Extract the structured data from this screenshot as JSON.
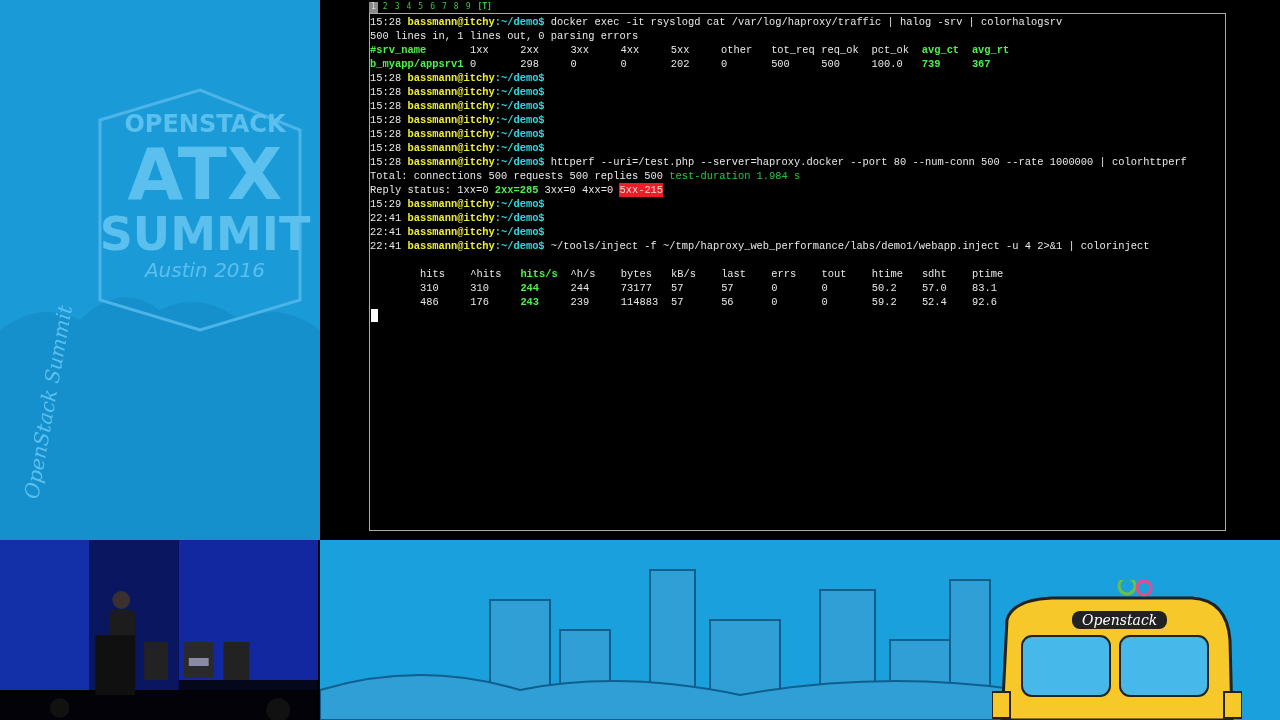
{
  "branding": {
    "logo_lines": [
      "OPENSTACK",
      "ATX",
      "SUMMIT",
      "Austin 2016"
    ],
    "vertical": "OpenStack Summit",
    "bus_label": "Openstack"
  },
  "tabs": [
    {
      "label": "1",
      "selected": true,
      "kind": "number"
    },
    {
      "label": "2",
      "selected": false,
      "kind": "number"
    },
    {
      "label": "3",
      "selected": false,
      "kind": "number"
    },
    {
      "label": "4",
      "selected": false,
      "kind": "number"
    },
    {
      "label": "5",
      "selected": false,
      "kind": "number"
    },
    {
      "label": "6",
      "selected": false,
      "kind": "number"
    },
    {
      "label": "7",
      "selected": false,
      "kind": "number"
    },
    {
      "label": "8",
      "selected": false,
      "kind": "number"
    },
    {
      "label": "9",
      "selected": false,
      "kind": "number"
    },
    {
      "label": "[T]",
      "selected": false,
      "kind": "flag"
    }
  ],
  "terminal": {
    "lines": [
      {
        "kind": "prompt",
        "time": "15:28",
        "user": "bassmann@itchy",
        "path": ":~/demo$",
        "command": "docker exec -it rsyslogd cat /var/log/haproxy/traffic | halog -srv | colorhalogsrv"
      },
      {
        "kind": "text",
        "segments": [
          {
            "text": "500 lines in, 1 lines out, 0 parsing errors",
            "kind": "plain"
          }
        ]
      },
      {
        "kind": "halog-row",
        "cells": [
          {
            "text": "#srv_name",
            "kind": "green"
          },
          {
            "text": "1xx",
            "kind": "plain"
          },
          {
            "text": "2xx",
            "kind": "plain"
          },
          {
            "text": "3xx",
            "kind": "plain"
          },
          {
            "text": "4xx",
            "kind": "plain"
          },
          {
            "text": "5xx",
            "kind": "plain"
          },
          {
            "text": "other",
            "kind": "plain"
          },
          {
            "text": "tot_req",
            "kind": "plain"
          },
          {
            "text": "req_ok",
            "kind": "plain"
          },
          {
            "text": "pct_ok",
            "kind": "plain"
          },
          {
            "text": "avg_ct",
            "kind": "green"
          },
          {
            "text": "avg_rt",
            "kind": "green"
          }
        ]
      },
      {
        "kind": "halog-row",
        "cells": [
          {
            "text": "b_myapp/appsrv1",
            "kind": "green"
          },
          {
            "text": "0",
            "kind": "plain"
          },
          {
            "text": "298",
            "kind": "plain"
          },
          {
            "text": "0",
            "kind": "plain"
          },
          {
            "text": "0",
            "kind": "plain"
          },
          {
            "text": "202",
            "kind": "plain"
          },
          {
            "text": "0",
            "kind": "plain"
          },
          {
            "text": "500",
            "kind": "plain"
          },
          {
            "text": "500",
            "kind": "plain"
          },
          {
            "text": "100.0",
            "kind": "plain"
          },
          {
            "text": "739",
            "kind": "green"
          },
          {
            "text": "367",
            "kind": "green"
          }
        ]
      },
      {
        "kind": "prompt",
        "time": "15:28",
        "user": "bassmann@itchy",
        "path": ":~/demo$"
      },
      {
        "kind": "prompt",
        "time": "15:28",
        "user": "bassmann@itchy",
        "path": ":~/demo$"
      },
      {
        "kind": "prompt",
        "time": "15:28",
        "user": "bassmann@itchy",
        "path": ":~/demo$"
      },
      {
        "kind": "prompt",
        "time": "15:28",
        "user": "bassmann@itchy",
        "path": ":~/demo$"
      },
      {
        "kind": "prompt",
        "time": "15:28",
        "user": "bassmann@itchy",
        "path": ":~/demo$"
      },
      {
        "kind": "prompt",
        "time": "15:28",
        "user": "bassmann@itchy",
        "path": ":~/demo$"
      },
      {
        "kind": "prompt",
        "time": "15:28",
        "user": "bassmann@itchy",
        "path": ":~/demo$",
        "command": "httperf --uri=/test.php --server=haproxy.docker --port 80 --num-conn 500 --rate 1000000 | colorhttperf"
      },
      {
        "kind": "text",
        "segments": [
          {
            "text": "Total: connections 500 requests 500 replies 500",
            "kind": "plain"
          },
          {
            "text": "test-duration 1.984 s",
            "kind": "dim-green"
          }
        ]
      },
      {
        "kind": "text",
        "segments": [
          {
            "text": "Reply status: 1xx=0",
            "kind": "plain"
          },
          {
            "text": "2xx=285",
            "kind": "green"
          },
          {
            "text": "3xx=0 4xx=0",
            "kind": "plain"
          },
          {
            "text": "5xx-215",
            "kind": "alert"
          }
        ]
      },
      {
        "kind": "prompt",
        "time": "15:29",
        "user": "bassmann@itchy",
        "path": ":~/demo$"
      },
      {
        "kind": "prompt",
        "time": "22:41",
        "user": "bassmann@itchy",
        "path": ":~/demo$"
      },
      {
        "kind": "prompt",
        "time": "22:41",
        "user": "bassmann@itchy",
        "path": ":~/demo$"
      },
      {
        "kind": "prompt",
        "time": "22:41",
        "user": "bassmann@itchy",
        "path": ":~/demo$",
        "command": "~/tools/inject -f ~/tmp/haproxy_web_performance/labs/demo1/webapp.inject -u 4 2>&1 | colorinject"
      },
      {
        "kind": "blank"
      },
      {
        "kind": "inject-row",
        "cells": [
          {
            "text": "hits",
            "kind": "plain"
          },
          {
            "text": "^hits",
            "kind": "plain"
          },
          {
            "text": "hits/s",
            "kind": "green"
          },
          {
            "text": "^h/s",
            "kind": "plain"
          },
          {
            "text": "bytes",
            "kind": "plain"
          },
          {
            "text": "kB/s",
            "kind": "plain"
          },
          {
            "text": "last",
            "kind": "plain"
          },
          {
            "text": "errs",
            "kind": "plain"
          },
          {
            "text": "tout",
            "kind": "plain"
          },
          {
            "text": "htime",
            "kind": "plain"
          },
          {
            "text": "sdht",
            "kind": "plain"
          },
          {
            "text": "ptime",
            "kind": "plain"
          }
        ]
      },
      {
        "kind": "inject-row",
        "cells": [
          {
            "text": "310",
            "kind": "plain"
          },
          {
            "text": "310",
            "kind": "plain"
          },
          {
            "text": "244",
            "kind": "green"
          },
          {
            "text": "244",
            "kind": "plain"
          },
          {
            "text": "73177",
            "kind": "plain"
          },
          {
            "text": "57",
            "kind": "plain"
          },
          {
            "text": "57",
            "kind": "plain"
          },
          {
            "text": "0",
            "kind": "plain"
          },
          {
            "text": "0",
            "kind": "plain"
          },
          {
            "text": "50.2",
            "kind": "plain"
          },
          {
            "text": "57.0",
            "kind": "plain"
          },
          {
            "text": "83.1",
            "kind": "plain"
          }
        ]
      },
      {
        "kind": "inject-row",
        "cells": [
          {
            "text": "486",
            "kind": "plain"
          },
          {
            "text": "176",
            "kind": "plain"
          },
          {
            "text": "243",
            "kind": "green"
          },
          {
            "text": "239",
            "kind": "plain"
          },
          {
            "text": "114883",
            "kind": "plain"
          },
          {
            "text": "57",
            "kind": "plain"
          },
          {
            "text": "56",
            "kind": "plain"
          },
          {
            "text": "0",
            "kind": "plain"
          },
          {
            "text": "0",
            "kind": "plain"
          },
          {
            "text": "59.2",
            "kind": "plain"
          },
          {
            "text": "52.4",
            "kind": "plain"
          },
          {
            "text": "92.6",
            "kind": "plain"
          }
        ]
      },
      {
        "kind": "cursor"
      }
    ]
  }
}
